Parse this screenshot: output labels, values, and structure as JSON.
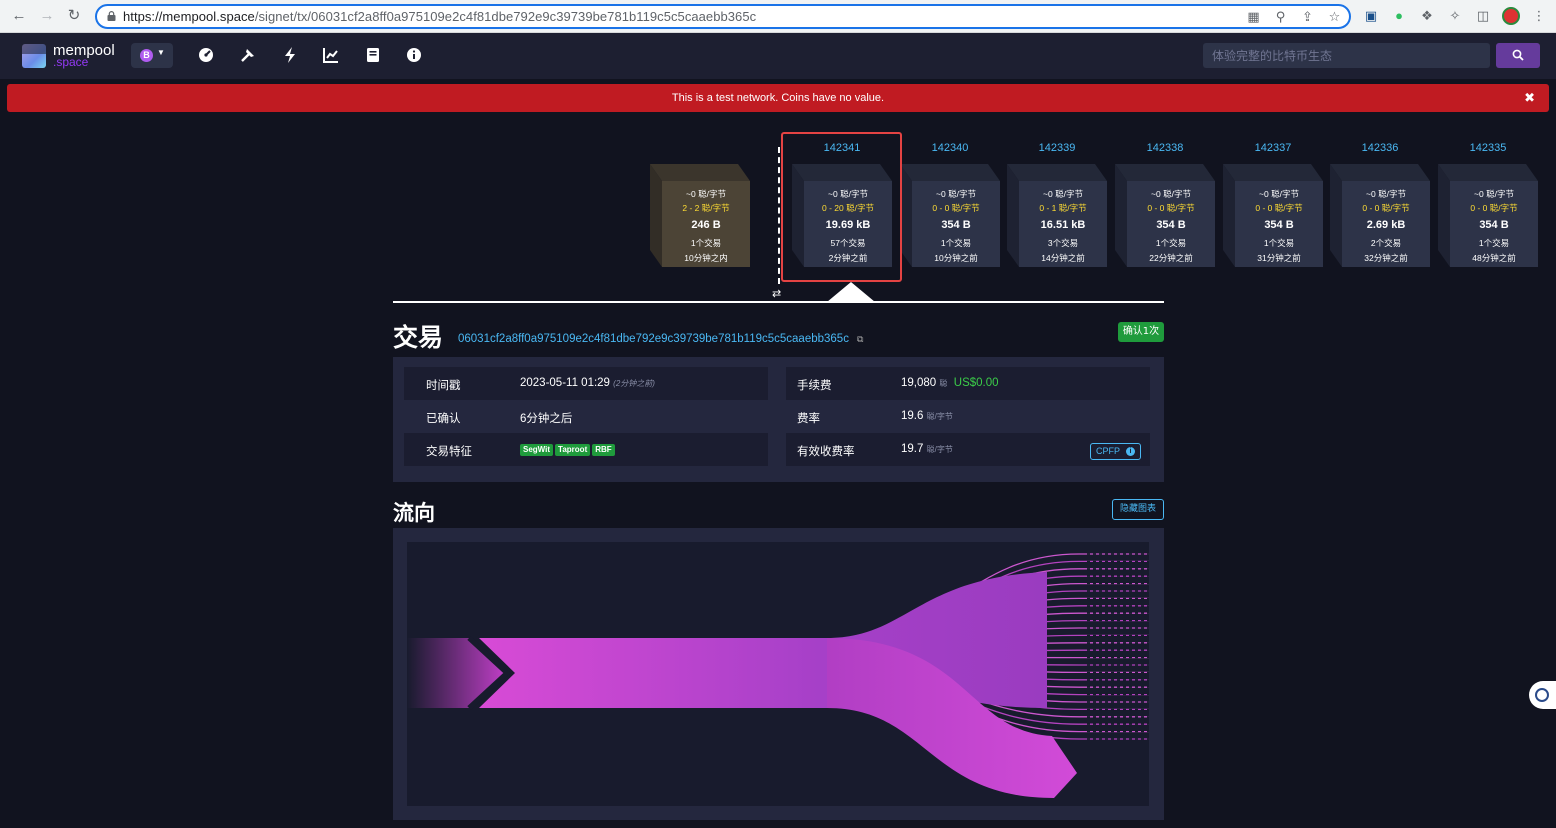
{
  "browser": {
    "url_host": "https://mempool.space",
    "url_path": "/signet/tx/06031cf2a8ff0a975109e2c4f81dbe792e9c39739be781b119c5c5caaebb365c"
  },
  "nav": {
    "logo_line1": "mempool",
    "logo_line2": ".space",
    "network_symbol": "B",
    "search_placeholder": "体验完整的比特币生态"
  },
  "alert": {
    "text": "This is a test network. Coins have no value.",
    "close": "✖"
  },
  "pending_block": {
    "fee": "~0 聪/字节",
    "range": "2 - 2 聪/字节",
    "size": "246 B",
    "tx_count": "1个交易",
    "time": "10分钟之内"
  },
  "blocks": [
    {
      "height": "142341",
      "fee": "~0 聪/字节",
      "range": "0 - 20 聪/字节",
      "size": "19.69 kB",
      "tx_count": "57个交易",
      "time": "2分钟之前"
    },
    {
      "height": "142340",
      "fee": "~0 聪/字节",
      "range": "0 - 0 聪/字节",
      "size": "354 B",
      "tx_count": "1个交易",
      "time": "10分钟之前"
    },
    {
      "height": "142339",
      "fee": "~0 聪/字节",
      "range": "0 - 1 聪/字节",
      "size": "16.51 kB",
      "tx_count": "3个交易",
      "time": "14分钟之前"
    },
    {
      "height": "142338",
      "fee": "~0 聪/字节",
      "range": "0 - 0 聪/字节",
      "size": "354 B",
      "tx_count": "1个交易",
      "time": "22分钟之前"
    },
    {
      "height": "142337",
      "fee": "~0 聪/字节",
      "range": "0 - 0 聪/字节",
      "size": "354 B",
      "tx_count": "1个交易",
      "time": "31分钟之前"
    },
    {
      "height": "142336",
      "fee": "~0 聪/字节",
      "range": "0 - 0 聪/字节",
      "size": "2.69 kB",
      "tx_count": "2个交易",
      "time": "32分钟之前"
    },
    {
      "height": "142335",
      "fee": "~0 聪/字节",
      "range": "0 - 0 聪/字节",
      "size": "354 B",
      "tx_count": "1个交易",
      "time": "48分钟之前"
    }
  ],
  "tx": {
    "title": "交易",
    "txid": "06031cf2a8ff0a975109e2c4f81dbe792e9c39739be781b119c5c5caaebb365c",
    "confirm_badge": "确认1次",
    "timestamp_label": "时间戳",
    "timestamp_value": "2023-05-11 01:29",
    "timestamp_rel": "(2分钟之前)",
    "confirmed_label": "已确认",
    "confirmed_value": "6分钟之后",
    "features_label": "交易特征",
    "features": [
      "SegWit",
      "Taproot",
      "RBF"
    ],
    "fee_label": "手续费",
    "fee_value": "19,080",
    "fee_unit": "聪",
    "fee_usd": "US$0.00",
    "feerate_label": "费率",
    "feerate_value": "19.6",
    "feerate_unit": "聪/字节",
    "eff_feerate_label": "有效收费率",
    "eff_feerate_value": "19.7",
    "eff_feerate_unit": "聪/字节",
    "cpfp_label": "CPFP"
  },
  "flow": {
    "title": "流向",
    "hide_button": "隐藏图表"
  },
  "colors": {
    "accent": "#4ab8f3",
    "flow": "#d24bd8",
    "confirm": "#1f9b3c",
    "alert": "#c01b22"
  }
}
